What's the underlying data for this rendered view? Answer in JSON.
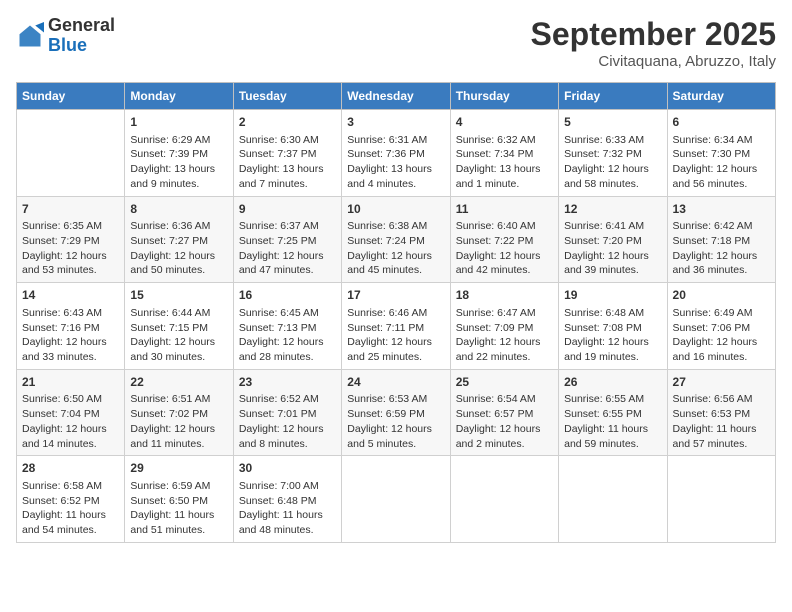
{
  "logo": {
    "general": "General",
    "blue": "Blue"
  },
  "title": "September 2025",
  "subtitle": "Civitaquana, Abruzzo, Italy",
  "headers": [
    "Sunday",
    "Monday",
    "Tuesday",
    "Wednesday",
    "Thursday",
    "Friday",
    "Saturday"
  ],
  "weeks": [
    [
      {
        "day": "",
        "info": ""
      },
      {
        "day": "1",
        "info": "Sunrise: 6:29 AM\nSunset: 7:39 PM\nDaylight: 13 hours\nand 9 minutes."
      },
      {
        "day": "2",
        "info": "Sunrise: 6:30 AM\nSunset: 7:37 PM\nDaylight: 13 hours\nand 7 minutes."
      },
      {
        "day": "3",
        "info": "Sunrise: 6:31 AM\nSunset: 7:36 PM\nDaylight: 13 hours\nand 4 minutes."
      },
      {
        "day": "4",
        "info": "Sunrise: 6:32 AM\nSunset: 7:34 PM\nDaylight: 13 hours\nand 1 minute."
      },
      {
        "day": "5",
        "info": "Sunrise: 6:33 AM\nSunset: 7:32 PM\nDaylight: 12 hours\nand 58 minutes."
      },
      {
        "day": "6",
        "info": "Sunrise: 6:34 AM\nSunset: 7:30 PM\nDaylight: 12 hours\nand 56 minutes."
      }
    ],
    [
      {
        "day": "7",
        "info": "Sunrise: 6:35 AM\nSunset: 7:29 PM\nDaylight: 12 hours\nand 53 minutes."
      },
      {
        "day": "8",
        "info": "Sunrise: 6:36 AM\nSunset: 7:27 PM\nDaylight: 12 hours\nand 50 minutes."
      },
      {
        "day": "9",
        "info": "Sunrise: 6:37 AM\nSunset: 7:25 PM\nDaylight: 12 hours\nand 47 minutes."
      },
      {
        "day": "10",
        "info": "Sunrise: 6:38 AM\nSunset: 7:24 PM\nDaylight: 12 hours\nand 45 minutes."
      },
      {
        "day": "11",
        "info": "Sunrise: 6:40 AM\nSunset: 7:22 PM\nDaylight: 12 hours\nand 42 minutes."
      },
      {
        "day": "12",
        "info": "Sunrise: 6:41 AM\nSunset: 7:20 PM\nDaylight: 12 hours\nand 39 minutes."
      },
      {
        "day": "13",
        "info": "Sunrise: 6:42 AM\nSunset: 7:18 PM\nDaylight: 12 hours\nand 36 minutes."
      }
    ],
    [
      {
        "day": "14",
        "info": "Sunrise: 6:43 AM\nSunset: 7:16 PM\nDaylight: 12 hours\nand 33 minutes."
      },
      {
        "day": "15",
        "info": "Sunrise: 6:44 AM\nSunset: 7:15 PM\nDaylight: 12 hours\nand 30 minutes."
      },
      {
        "day": "16",
        "info": "Sunrise: 6:45 AM\nSunset: 7:13 PM\nDaylight: 12 hours\nand 28 minutes."
      },
      {
        "day": "17",
        "info": "Sunrise: 6:46 AM\nSunset: 7:11 PM\nDaylight: 12 hours\nand 25 minutes."
      },
      {
        "day": "18",
        "info": "Sunrise: 6:47 AM\nSunset: 7:09 PM\nDaylight: 12 hours\nand 22 minutes."
      },
      {
        "day": "19",
        "info": "Sunrise: 6:48 AM\nSunset: 7:08 PM\nDaylight: 12 hours\nand 19 minutes."
      },
      {
        "day": "20",
        "info": "Sunrise: 6:49 AM\nSunset: 7:06 PM\nDaylight: 12 hours\nand 16 minutes."
      }
    ],
    [
      {
        "day": "21",
        "info": "Sunrise: 6:50 AM\nSunset: 7:04 PM\nDaylight: 12 hours\nand 14 minutes."
      },
      {
        "day": "22",
        "info": "Sunrise: 6:51 AM\nSunset: 7:02 PM\nDaylight: 12 hours\nand 11 minutes."
      },
      {
        "day": "23",
        "info": "Sunrise: 6:52 AM\nSunset: 7:01 PM\nDaylight: 12 hours\nand 8 minutes."
      },
      {
        "day": "24",
        "info": "Sunrise: 6:53 AM\nSunset: 6:59 PM\nDaylight: 12 hours\nand 5 minutes."
      },
      {
        "day": "25",
        "info": "Sunrise: 6:54 AM\nSunset: 6:57 PM\nDaylight: 12 hours\nand 2 minutes."
      },
      {
        "day": "26",
        "info": "Sunrise: 6:55 AM\nSunset: 6:55 PM\nDaylight: 11 hours\nand 59 minutes."
      },
      {
        "day": "27",
        "info": "Sunrise: 6:56 AM\nSunset: 6:53 PM\nDaylight: 11 hours\nand 57 minutes."
      }
    ],
    [
      {
        "day": "28",
        "info": "Sunrise: 6:58 AM\nSunset: 6:52 PM\nDaylight: 11 hours\nand 54 minutes."
      },
      {
        "day": "29",
        "info": "Sunrise: 6:59 AM\nSunset: 6:50 PM\nDaylight: 11 hours\nand 51 minutes."
      },
      {
        "day": "30",
        "info": "Sunrise: 7:00 AM\nSunset: 6:48 PM\nDaylight: 11 hours\nand 48 minutes."
      },
      {
        "day": "",
        "info": ""
      },
      {
        "day": "",
        "info": ""
      },
      {
        "day": "",
        "info": ""
      },
      {
        "day": "",
        "info": ""
      }
    ]
  ]
}
